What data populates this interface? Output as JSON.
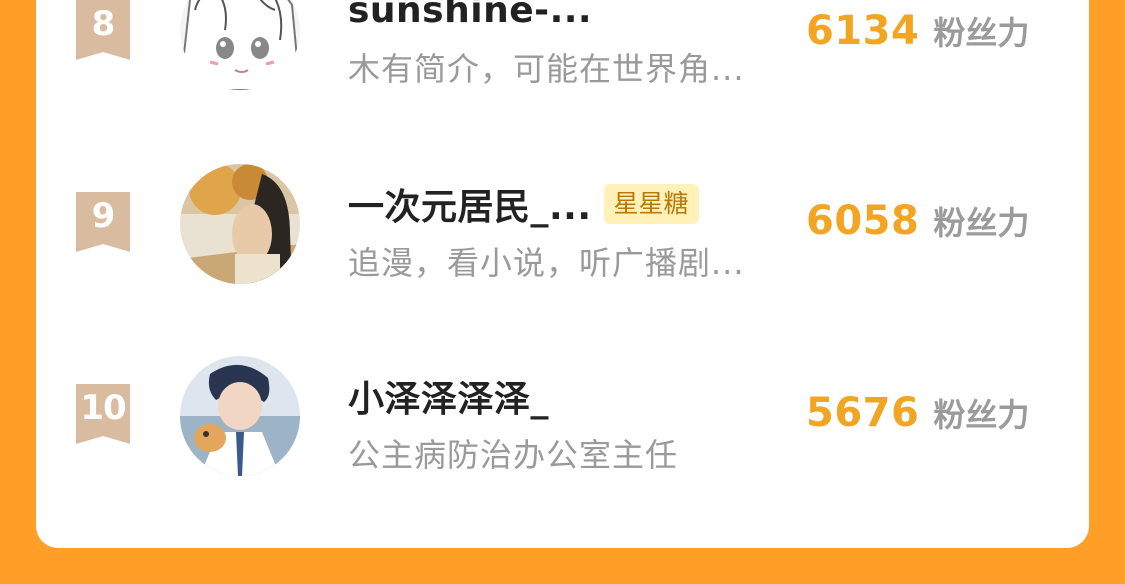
{
  "leaderboard": {
    "metric_unit": "粉丝力",
    "entries": [
      {
        "rank": "8",
        "name": "sunshine-...",
        "badge": "",
        "bio": "木有简介，可能在世界角...",
        "score": "6134",
        "avatar_style": "manga-girl-sketch"
      },
      {
        "rank": "9",
        "name": "一次元居民_...",
        "badge": "星星糖",
        "bio": "追漫，看小说，听广播剧...",
        "score": "6058",
        "avatar_style": "photo-autumn-trees"
      },
      {
        "rank": "10",
        "name": "小泽泽泽泽_",
        "badge": "",
        "bio": "公主病防治办公室主任",
        "score": "5676",
        "avatar_style": "anime-boy-with-cat"
      }
    ]
  },
  "colors": {
    "background": "#FF9F28",
    "card": "#FFFFFF",
    "rank_ribbon": "#D9BBA0",
    "score": "#F2A523",
    "badge_bg": "#FFF1B8",
    "badge_text": "#B8790A"
  }
}
